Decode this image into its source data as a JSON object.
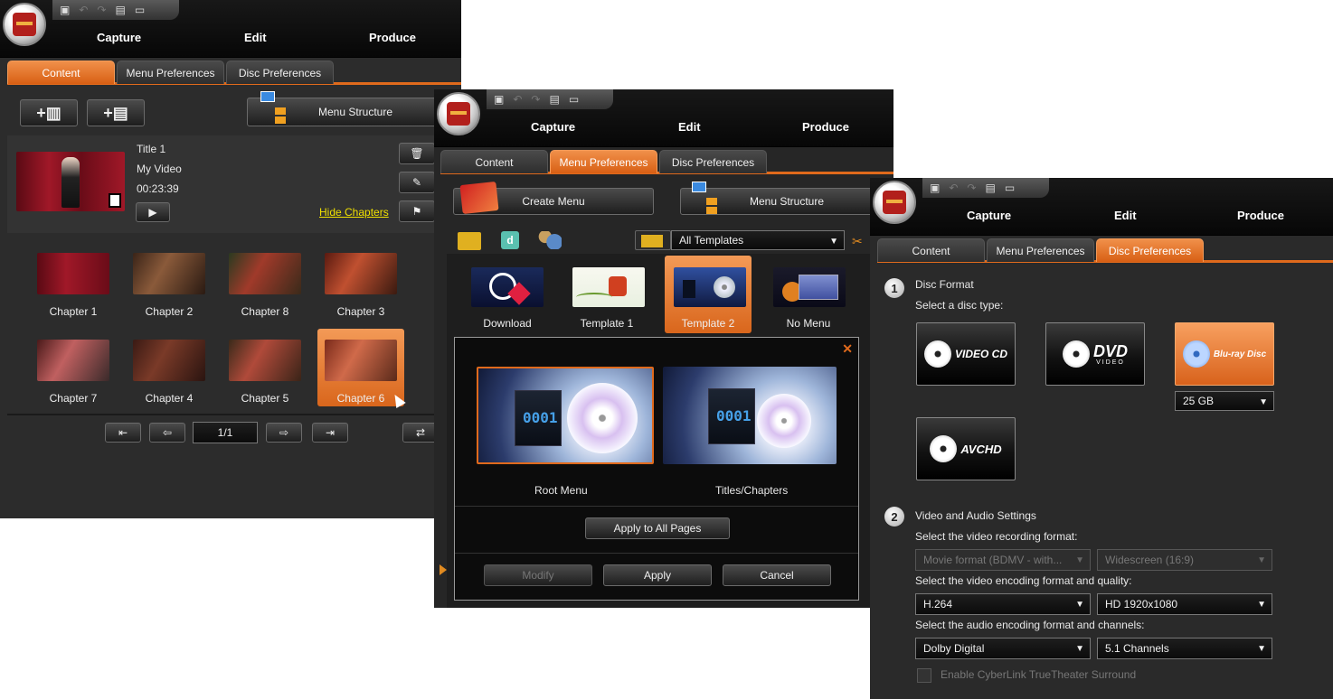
{
  "app": {
    "nav": [
      "Capture",
      "Edit",
      "Produce"
    ],
    "tabs": [
      "Content",
      "Menu Preferences",
      "Disc Preferences"
    ]
  },
  "content_window": {
    "toolbar": {
      "menu_structure": "Menu Structure"
    },
    "title_info": {
      "title": "Title 1",
      "name": "My Video",
      "duration": "00:23:39"
    },
    "hide_chapters": "Hide Chapters",
    "chapters": [
      "Chapter 1",
      "Chapter 2",
      "Chapter 8",
      "Chapter 3",
      "Chapter 7",
      "Chapter 4",
      "Chapter 5",
      "Chapter 6"
    ],
    "selected_chapter": "Chapter 6",
    "page_indicator": "1/1"
  },
  "menu_window": {
    "create_menu": "Create Menu",
    "menu_structure": "Menu Structure",
    "template_filter": "All Templates",
    "templates": [
      "Download",
      "Template 1",
      "Template 2",
      "No Menu"
    ],
    "selected_template": "Template 2",
    "pages": [
      {
        "label": "Root Menu",
        "number": "0001"
      },
      {
        "label": "Titles/Chapters",
        "number": "0001"
      }
    ],
    "apply_all": "Apply to All Pages",
    "modify": "Modify",
    "apply": "Apply",
    "cancel": "Cancel",
    "close_glyph": "✕"
  },
  "disc_window": {
    "section1": {
      "num": "1",
      "title": "Disc Format",
      "prompt": "Select a disc type:"
    },
    "disc_types": [
      "VIDEO CD",
      "DVD",
      "Blu-ray Disc",
      "AVCHD"
    ],
    "disc_type_subtexts": [
      "",
      "VIDEO",
      "",
      ""
    ],
    "selected_disc": "Blu-ray Disc",
    "capacity": "25 GB",
    "section2": {
      "num": "2",
      "title": "Video and Audio Settings"
    },
    "recording_prompt": "Select the video recording format:",
    "recording_format": "Movie format (BDMV - with...",
    "aspect": "Widescreen (16:9)",
    "encoding_prompt": "Select the video encoding format and quality:",
    "encoding_format": "H.264",
    "quality": "HD 1920x1080",
    "audio_prompt": "Select the audio encoding format and channels:",
    "audio_format": "Dolby Digital",
    "channels": "5.1 Channels",
    "truetheater": "Enable CyberLink TrueTheater Surround"
  },
  "colors": {
    "accent": "#e06a1c",
    "link": "#f0e000",
    "background": "#2b2b2b"
  },
  "icons": [
    "save-icon",
    "undo-icon",
    "redo-icon",
    "new-icon",
    "open-icon",
    "trash-icon",
    "pencil-icon",
    "flag-icon",
    "play-icon",
    "first-page-icon",
    "prev-page-icon",
    "next-page-icon",
    "last-page-icon",
    "swap-icon",
    "folder-import-icon",
    "dailymotion-icon",
    "user-globe-icon",
    "folder-settings-icon",
    "close-icon"
  ]
}
